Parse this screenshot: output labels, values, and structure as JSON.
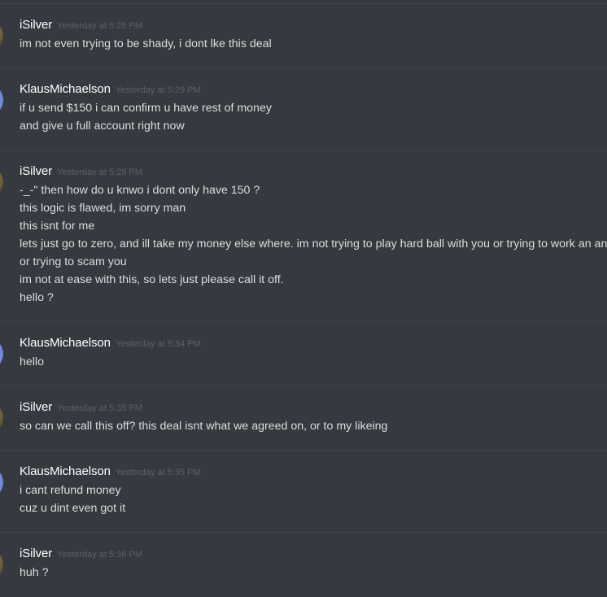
{
  "messages": [
    {
      "author": "iSilver",
      "time": "Yesterday at 5:28 PM",
      "avatar": "gold-avatar",
      "lines": [
        "im not even trying to be shady, i dont lke this deal"
      ]
    },
    {
      "author": "KlausMichaelson",
      "time": "Yesterday at 5:29 PM",
      "avatar": "discord-default-avatar",
      "lines": [
        "if u send $150 i can confirm u have rest of money",
        "and give u full account right now"
      ]
    },
    {
      "author": "iSilver",
      "time": "Yesterday at 5:29 PM",
      "avatar": "gold-avatar",
      "lines": [
        "-_-\" then how do u knwo i dont only have 150 ?",
        "this logic is flawed, im sorry man",
        "this isnt for me",
        "lets just go to zero, and ill take my money else where. im not trying to play hard ball with you or trying to work an ang",
        "or trying to scam you",
        "im not at ease with this, so lets just please call it off.",
        "hello ?"
      ]
    },
    {
      "author": "KlausMichaelson",
      "time": "Yesterday at 5:34 PM",
      "avatar": "discord-default-avatar",
      "lines": [
        "hello"
      ]
    },
    {
      "author": "iSilver",
      "time": "Yesterday at 5:35 PM",
      "avatar": "gold-avatar",
      "lines": [
        "so can we call this off? this deal isnt what we agreed on, or to my likeing"
      ]
    },
    {
      "author": "KlausMichaelson",
      "time": "Yesterday at 5:35 PM",
      "avatar": "discord-default-avatar",
      "lines": [
        "i cant refund money",
        "cuz u dint even got it"
      ]
    },
    {
      "author": "iSilver",
      "time": "Yesterday at 5:36 PM",
      "avatar": "gold-avatar",
      "lines": [
        "huh ?"
      ]
    }
  ],
  "colors": {
    "background": "#36393f",
    "divider": "#40444b",
    "username": "#ffffff",
    "timestamp": "#5c6167",
    "text": "#dcddde",
    "avatar_blurple": "#7289da"
  }
}
